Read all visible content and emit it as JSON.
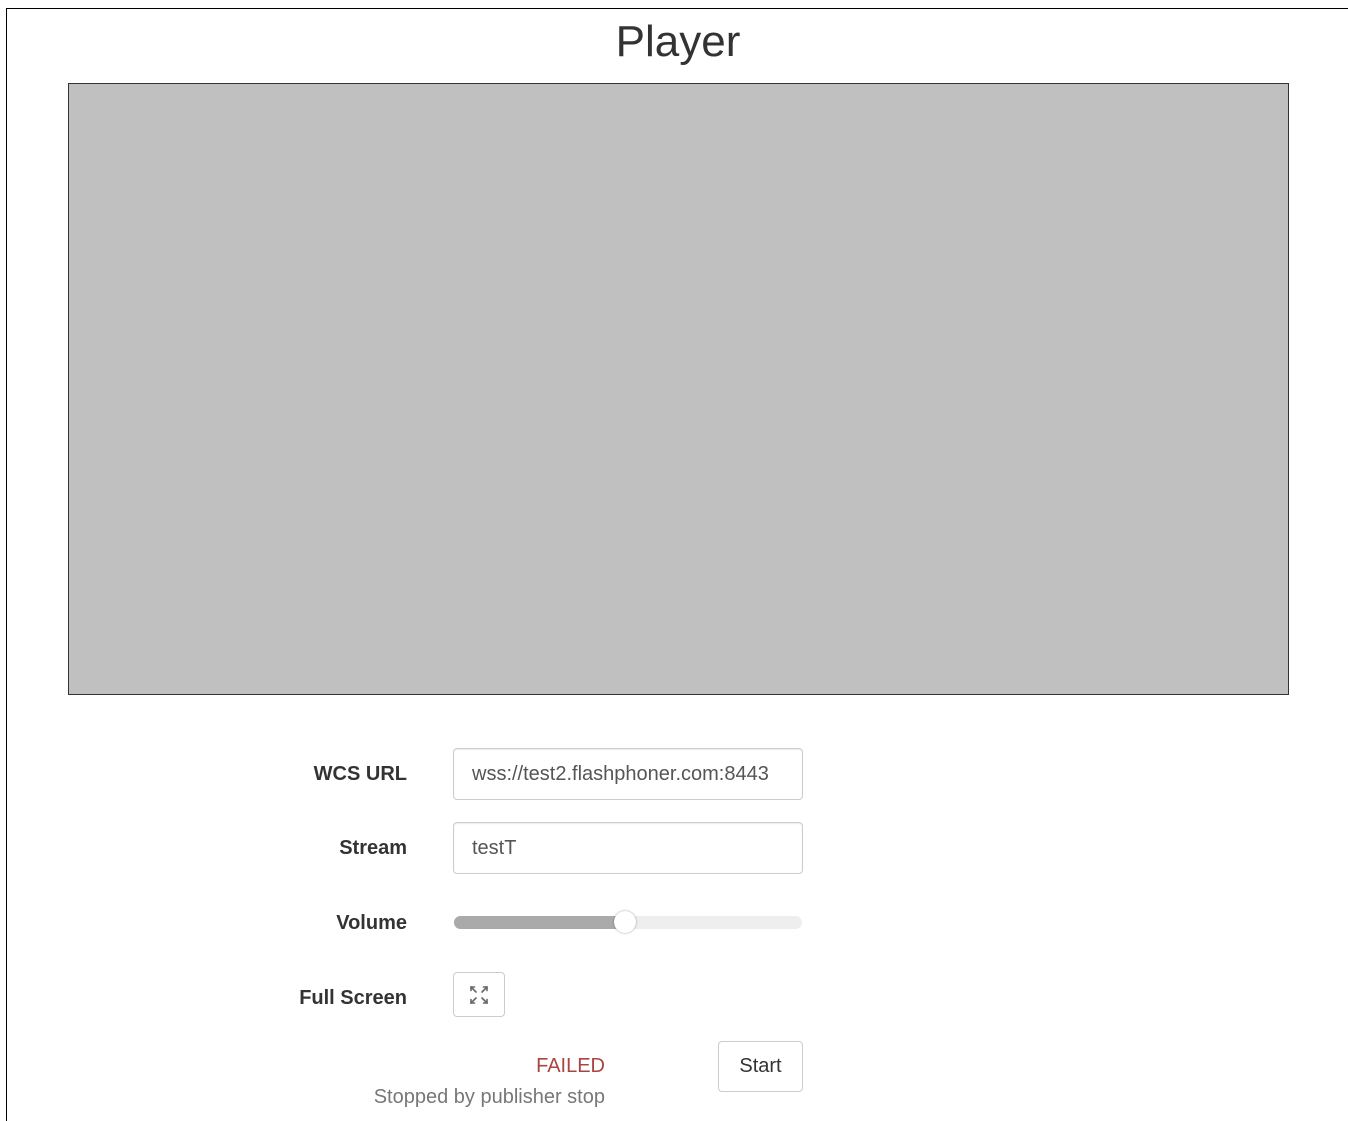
{
  "page": {
    "title": "Player"
  },
  "form": {
    "url_label": "WCS URL",
    "url_value": "wss://test2.flashphoner.com:8443",
    "stream_label": "Stream",
    "stream_value": "testT",
    "volume_label": "Volume",
    "volume_level_percent": 49,
    "fullscreen_label": "Full Screen",
    "fullscreen_icon": "expand-arrows-icon"
  },
  "status": {
    "state": "FAILED",
    "info": "Stopped by publisher stop"
  },
  "controls": {
    "start_label": "Start"
  },
  "colors": {
    "video_background": "#c0c0c0",
    "status_failed": "#a94442",
    "status_info": "#777777",
    "slider_fill": "#aaaaaa",
    "slider_track": "#eeeeee"
  }
}
